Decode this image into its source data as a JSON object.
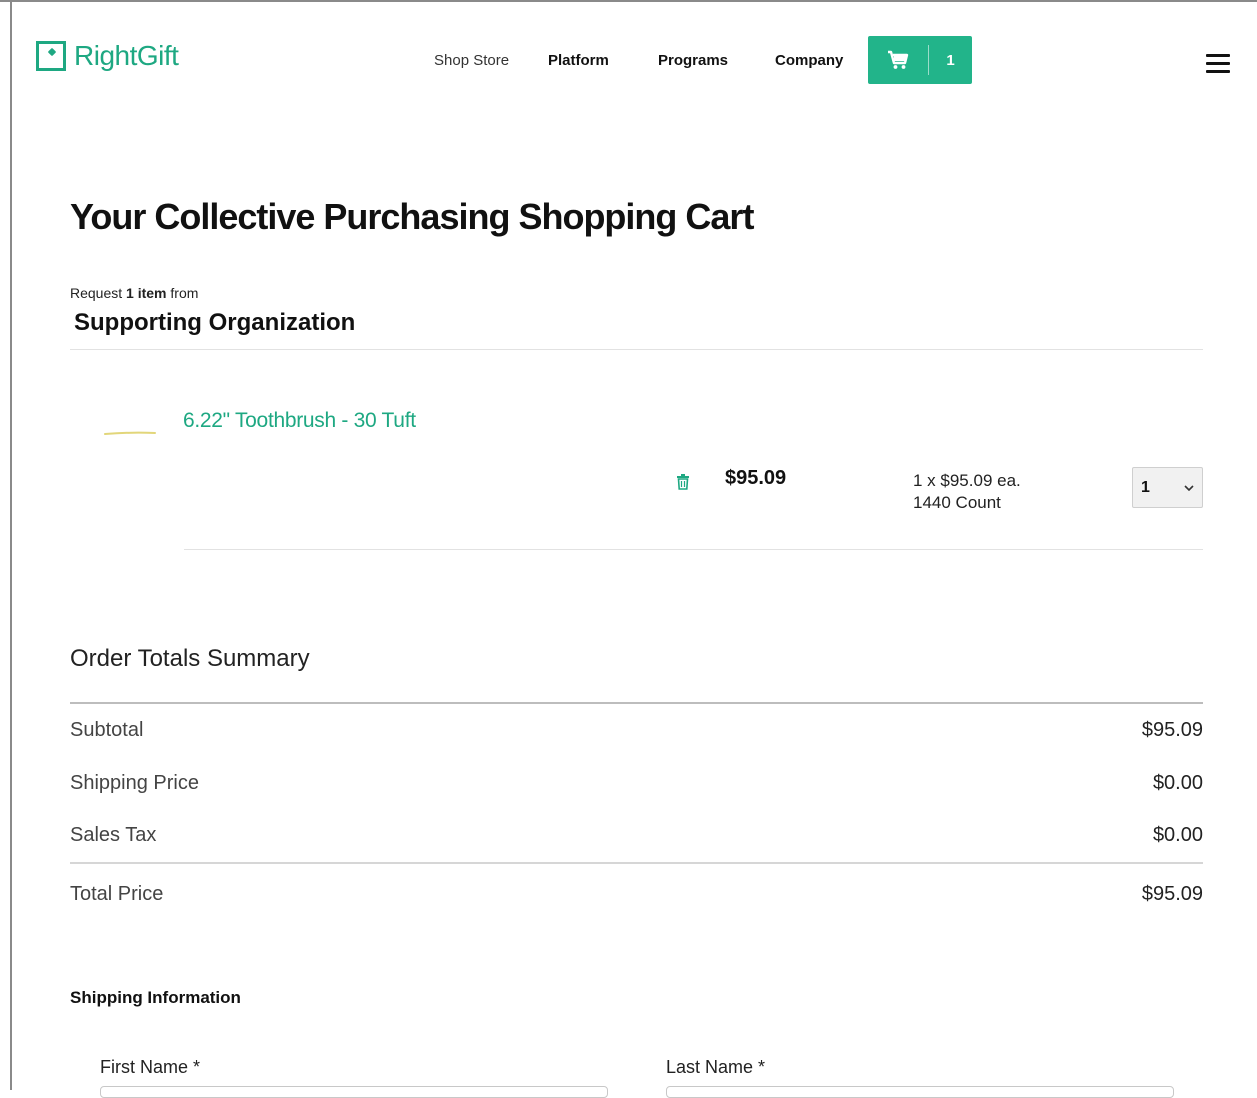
{
  "header": {
    "logo_text": "RightGift",
    "nav": {
      "shop_store": "Shop Store",
      "platform": "Platform",
      "programs": "Programs",
      "company": "Company"
    },
    "cart_count": "1",
    "icons": {
      "cart": "cart-icon",
      "menu": "hamburger-menu-icon",
      "logo": "logo-gift-icon"
    }
  },
  "page": {
    "title": "Your Collective Purchasing Shopping Cart",
    "request_prefix": "Request",
    "request_count": "1 item",
    "request_suffix": "from",
    "organization": "Supporting Organization"
  },
  "cart_item": {
    "name": "6.22\" Toothbrush - 30 Tuft",
    "price": "$95.09",
    "unit_line": "1 x $95.09 ea.",
    "pack_line": "1440 Count",
    "quantity": "1",
    "icons": {
      "remove": "trash-icon",
      "dropdown": "chevron-down-icon"
    }
  },
  "summary": {
    "title": "Order Totals Summary",
    "rows": [
      {
        "label": "Subtotal",
        "amount": "$95.09"
      },
      {
        "label": "Shipping Price",
        "amount": "$0.00"
      },
      {
        "label": "Sales Tax",
        "amount": "$0.00"
      },
      {
        "label": "Total Price",
        "amount": "$95.09"
      }
    ]
  },
  "shipping": {
    "title": "Shipping Information",
    "first_name_label": "First Name *",
    "last_name_label": "Last Name *"
  },
  "colors": {
    "brand": "#1ea882",
    "cart_button": "#22b48a",
    "text": "#111111",
    "divider": "#e2e2e2"
  }
}
